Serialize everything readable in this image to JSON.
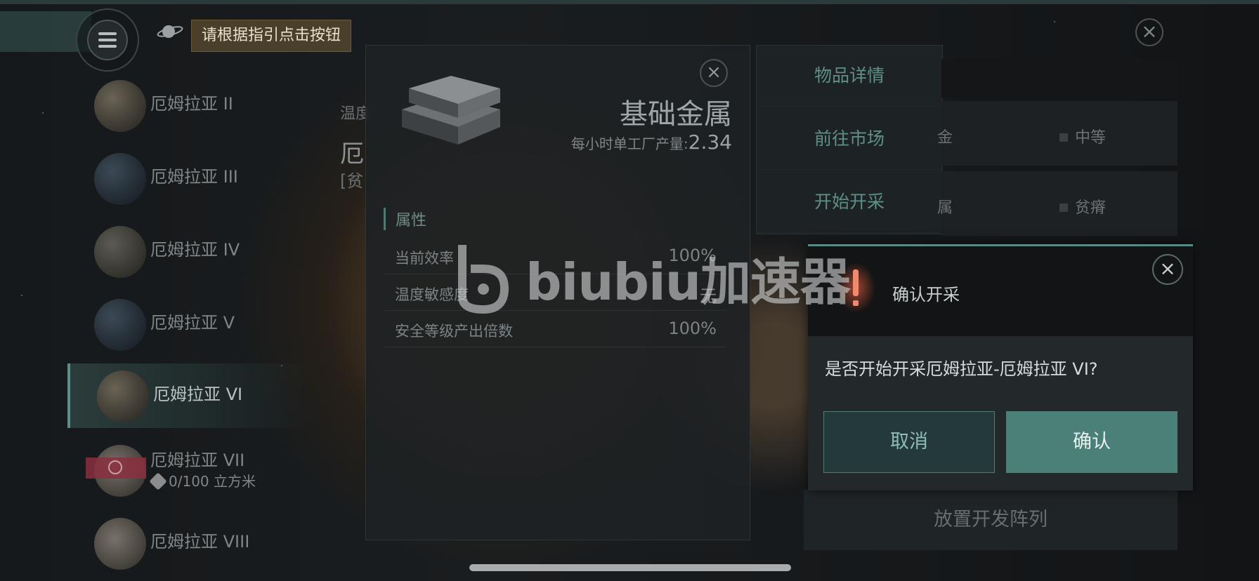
{
  "header": {
    "guide_tip": "请根据指引点击按钮",
    "close_glyph": "×",
    "icons": [
      "menu-icon",
      "planet-icon",
      "close-icon"
    ]
  },
  "planet_list": [
    {
      "name": "厄姆拉亚 II",
      "selected": false
    },
    {
      "name": "厄姆拉亚 III",
      "selected": false
    },
    {
      "name": "厄姆拉亚 IV",
      "selected": false
    },
    {
      "name": "厄姆拉亚 V",
      "selected": false
    },
    {
      "name": "厄姆拉亚 VI",
      "selected": true
    },
    {
      "name": "厄姆拉亚 VII",
      "selected": false,
      "capacity": "0/100 立方米"
    },
    {
      "name": "厄姆拉亚 VIII",
      "selected": false
    }
  ],
  "background_labels": {
    "temp": "温度",
    "planet_initial": "厄",
    "quality_prefix": "[贫"
  },
  "resource_panel": {
    "title": "基础金属",
    "rate_label": "每小时单工厂产量:",
    "rate_value": "2.34",
    "attributes_heading": "属性",
    "attributes": [
      {
        "label": "当前效率",
        "value": "100%"
      },
      {
        "label": "温度敏感度",
        "value": "无"
      },
      {
        "label": "安全等级产出倍数",
        "value": "100%"
      }
    ],
    "close_glyph": "×"
  },
  "context_menu": {
    "items": [
      "物品详情",
      "前往市场",
      "开始开采"
    ]
  },
  "right_table": {
    "rows": [
      {
        "col1": "金",
        "col2": "中等"
      },
      {
        "col1": "属",
        "col2": "贫瘠"
      }
    ],
    "place_array_label": "放置开发阵列"
  },
  "confirm_dialog": {
    "title": "确认开采",
    "message": "是否开始开采厄姆拉亚-厄姆拉亚 VI?",
    "cancel_label": "取消",
    "confirm_label": "确认",
    "warning_glyph": "!",
    "close_glyph": "×"
  },
  "watermark": {
    "text": "biubiu加速器"
  },
  "colors": {
    "accent_teal": "#4a8078",
    "warning_red": "#d9553f",
    "guide_tip_bg": "#4a3f2a"
  }
}
